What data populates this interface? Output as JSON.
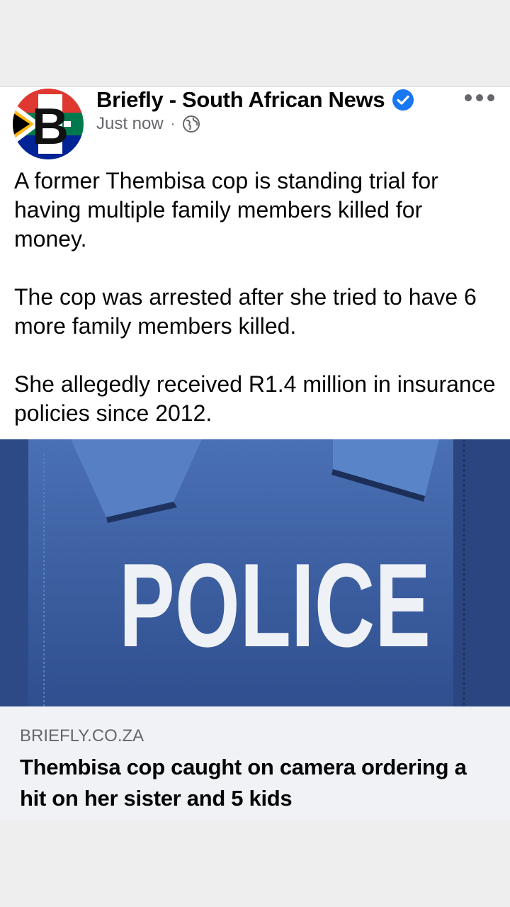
{
  "post": {
    "page_name": "Briefly - South African News",
    "timestamp": "Just now",
    "separator": "·",
    "verified_icon": "verified-badge-icon",
    "privacy_icon": "globe-icon",
    "more_icon": "more-options-icon",
    "paragraphs": [
      "A former Thembisa cop is standing trial for having multiple family members killed for money.",
      "The cop was arrested after she tried to have 6 more family members killed.",
      "She allegedly received R1.4 million in insurance policies since 2012."
    ],
    "image_text": "POLICE",
    "link": {
      "domain": "BRIEFLY.CO.ZA",
      "title": "Thembisa cop caught on camera ordering a hit on her sister and 5 kids"
    },
    "colors": {
      "accent_blue": "#1877f2",
      "secondary_text": "#65676b",
      "vest_blue": "#3a5fa6"
    }
  }
}
